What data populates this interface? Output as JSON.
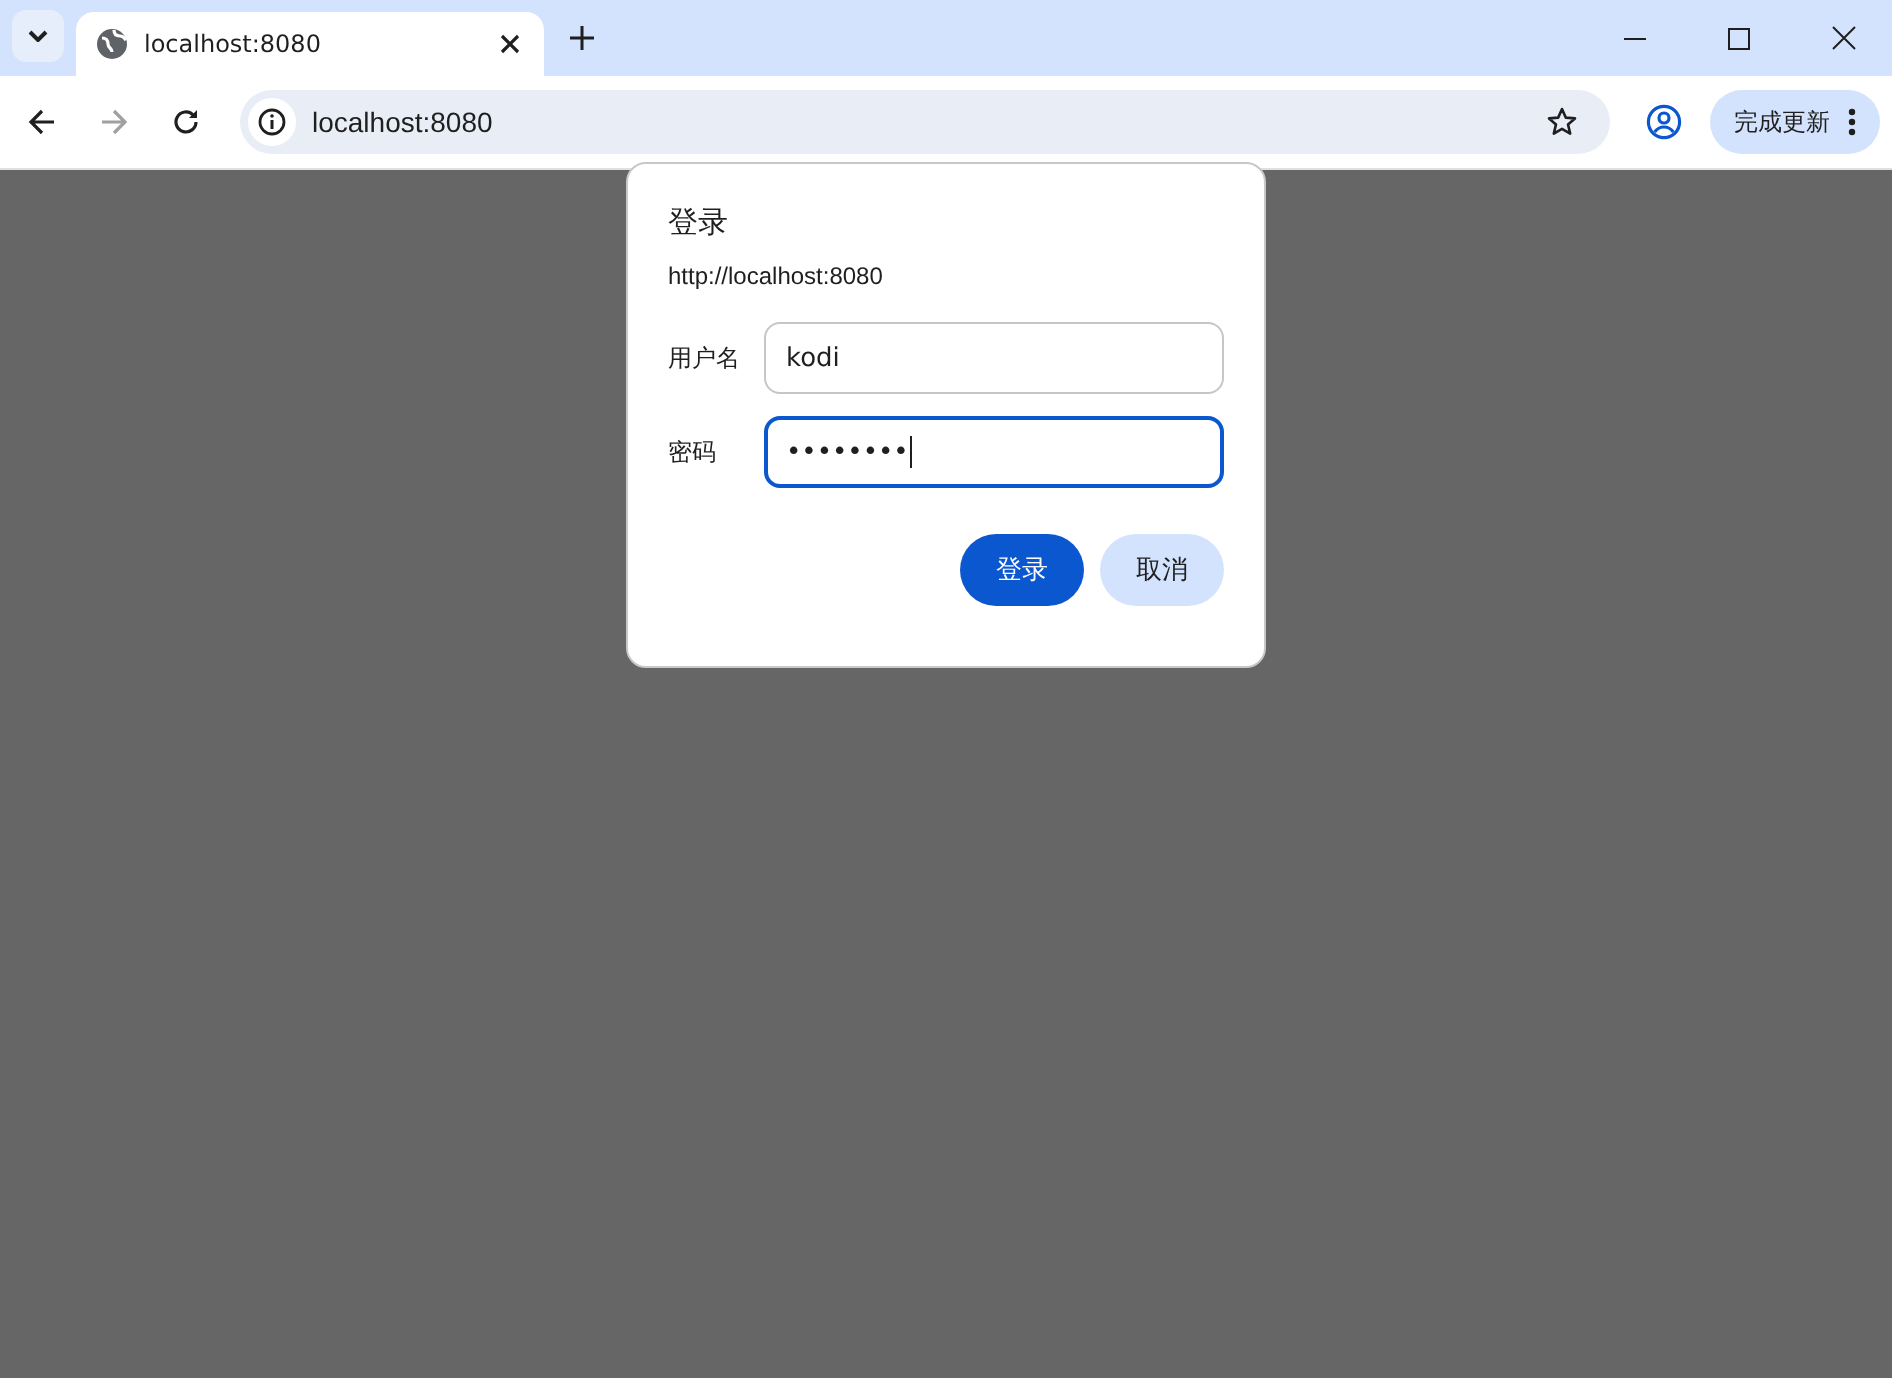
{
  "tab": {
    "title": "localhost:8080",
    "selected": true
  },
  "address_bar": {
    "url": "localhost:8080"
  },
  "update_button": {
    "label": "完成更新"
  },
  "dialog": {
    "title": "登录",
    "origin": "http://localhost:8080",
    "fields": [
      {
        "label": "用户名",
        "value": "kodi",
        "focused": false
      },
      {
        "label": "密码",
        "value": "••••••••",
        "focused": true
      }
    ],
    "buttons": [
      {
        "label": "登录",
        "kind": "primary"
      },
      {
        "label": "取消",
        "kind": "secondary"
      }
    ]
  }
}
